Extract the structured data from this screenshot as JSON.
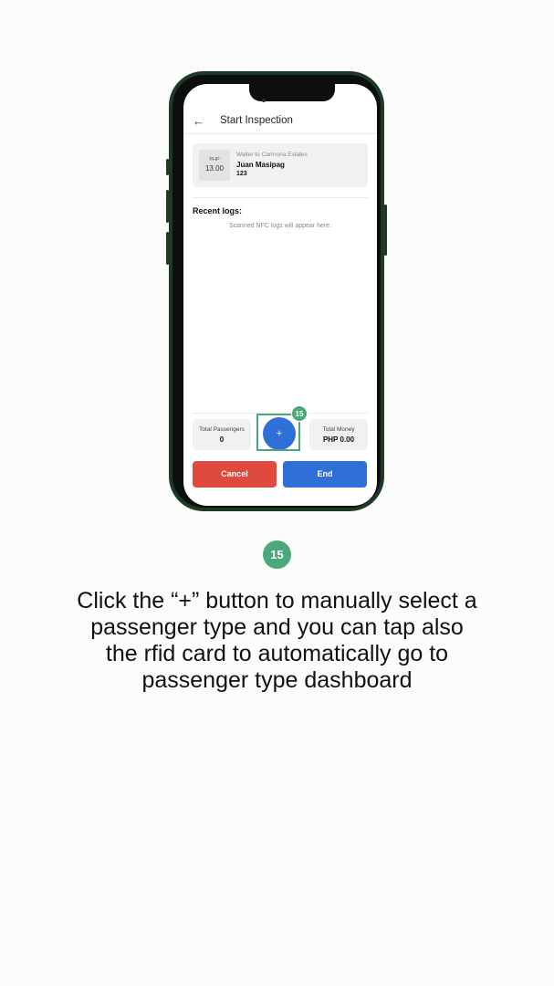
{
  "app": {
    "title": "Start Inspection",
    "back_icon": "arrow-left-icon"
  },
  "trip": {
    "currency": "PHP",
    "fare": "13.00",
    "route": "Walter to Carmona Estates",
    "passenger_name": "Juan Masipag",
    "passenger_id": "123"
  },
  "logs": {
    "title": "Recent logs:",
    "empty_message": "Scanned NFC logs will appear here."
  },
  "stats": {
    "passengers_label": "Total Passengers",
    "passengers_value": "0",
    "money_label": "Total Money",
    "money_value": "PHP 0.00"
  },
  "add_button": {
    "label": "+",
    "icon": "plus-icon"
  },
  "actions": {
    "cancel_label": "Cancel",
    "end_label": "End"
  },
  "step": {
    "number": "15"
  },
  "caption": "Click the “+” button to manually select a passenger type and you can tap also the rfid card to automatically go to passenger type dashboard",
  "colors": {
    "accent": "#4aa87a",
    "primary": "#2f6fd8",
    "danger": "#e04a3e"
  }
}
